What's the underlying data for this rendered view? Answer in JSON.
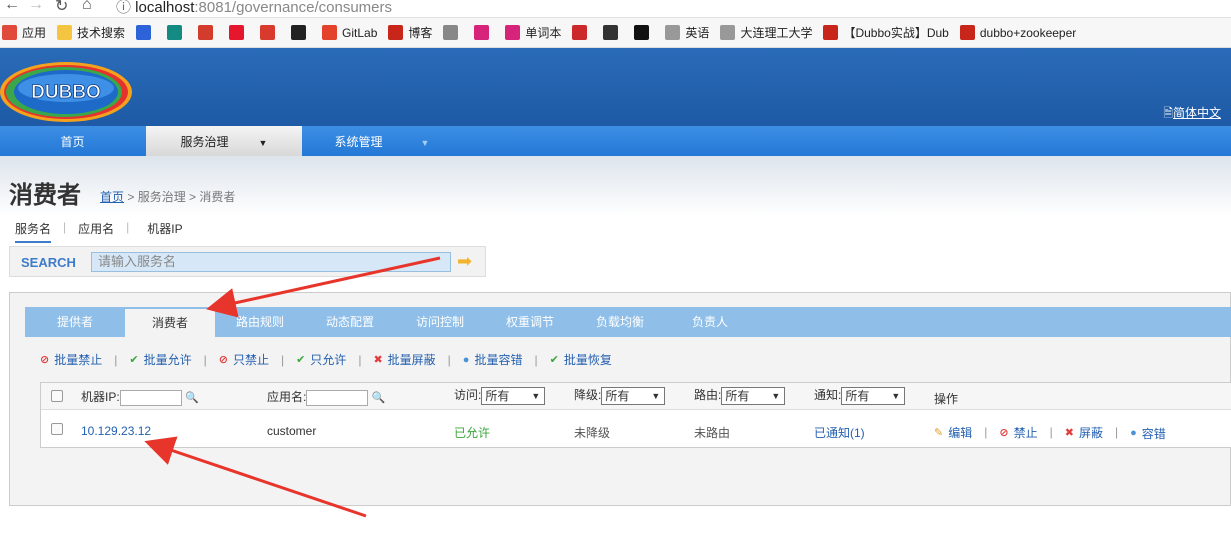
{
  "browser": {
    "url_host": "localhost",
    "url_rest": ":8081/governance/consumers",
    "bookmarks": [
      {
        "label": "应用",
        "icon": "apps-grid-icon",
        "color": "#e04a3a"
      },
      {
        "label": "技术搜索",
        "icon": "folder-icon",
        "color": "#f5c542"
      },
      {
        "label": "",
        "icon": "baidu-paw-icon",
        "color": "#2d62d8"
      },
      {
        "label": "",
        "icon": "bing-icon",
        "color": "#138a82"
      },
      {
        "label": "",
        "icon": "gmail-icon",
        "color": "#d33b2c"
      },
      {
        "label": "",
        "icon": "weibo-icon",
        "color": "#e6162d"
      },
      {
        "label": "",
        "icon": "e-doc-icon",
        "color": "#d83a2e"
      },
      {
        "label": "",
        "icon": "github-icon",
        "color": "#222222"
      },
      {
        "label": "GitLab",
        "icon": "gitlab-icon",
        "color": "#e2432a"
      },
      {
        "label": "博客",
        "icon": "csdn-icon",
        "color": "#c9261b"
      },
      {
        "label": "",
        "icon": "translate-icon",
        "color": "#888888"
      },
      {
        "label": "",
        "icon": "y-icon",
        "color": "#d6247a"
      },
      {
        "label": "单词本",
        "icon": "y-icon",
        "color": "#d6247a"
      },
      {
        "label": "",
        "icon": "h-icon",
        "color": "#cc2a2a"
      },
      {
        "label": "",
        "icon": "link-icon",
        "color": "#333333"
      },
      {
        "label": "",
        "icon": "spade-icon",
        "color": "#111111"
      },
      {
        "label": "英语",
        "icon": "page-icon",
        "color": "#999999"
      },
      {
        "label": "大连理工大学",
        "icon": "page-icon",
        "color": "#999999"
      },
      {
        "label": "【Dubbo实战】Dub",
        "icon": "csdn-icon",
        "color": "#c9261b"
      },
      {
        "label": "dubbo+zookeeper",
        "icon": "csdn-icon",
        "color": "#c9261b"
      }
    ]
  },
  "header": {
    "logo_text": "DUBBO",
    "lang": "简体中文"
  },
  "menu": {
    "items": [
      {
        "label": "首页"
      },
      {
        "label": "服务治理"
      },
      {
        "label": "系统管理"
      }
    ]
  },
  "page": {
    "title": "消费者",
    "breadcrumb_home": "首页",
    "breadcrumb_rest": " > 服务治理 > 消费者"
  },
  "search": {
    "tabs": [
      "服务名",
      "应用名",
      "机器IP"
    ],
    "label": "SEARCH",
    "placeholder": "请输入服务名"
  },
  "tabs": [
    "提供者",
    "消费者",
    "路由规则",
    "动态配置",
    "访问控制",
    "权重调节",
    "负载均衡",
    "负责人"
  ],
  "actions": [
    {
      "label": "批量禁止",
      "icon": "ban-icon",
      "glyph": "⊘",
      "tone": "red"
    },
    {
      "label": "批量允许",
      "icon": "check-icon",
      "glyph": "✔",
      "tone": "green"
    },
    {
      "label": "只禁止",
      "icon": "ban-icon",
      "glyph": "⊘",
      "tone": "red"
    },
    {
      "label": "只允许",
      "icon": "check-icon",
      "glyph": "✔",
      "tone": "green"
    },
    {
      "label": "批量屏蔽",
      "icon": "block-icon",
      "glyph": "✖",
      "tone": "red"
    },
    {
      "label": "批量容错",
      "icon": "tolerance-icon",
      "glyph": "●",
      "tone": "blue"
    },
    {
      "label": "批量恢复",
      "icon": "check-icon",
      "glyph": "✔",
      "tone": "green"
    }
  ],
  "table": {
    "headers": {
      "ip": "机器IP:",
      "app": "应用名:",
      "access": "访问:",
      "degrade": "降级:",
      "route": "路由:",
      "notify": "通知:",
      "ops": "操作"
    },
    "filter_all": "所有",
    "rows": [
      {
        "ip": "10.129.23.12",
        "app": "customer",
        "access": "已允许",
        "degrade": "未降级",
        "route": "未路由",
        "notify": "已通知(1)",
        "ops": [
          "编辑",
          "禁止",
          "屏蔽",
          "容错"
        ]
      }
    ]
  },
  "colors": {
    "header_blue": "#1e5aa5",
    "menu_blue": "#2478d6",
    "tab_blue": "#8fbfe8",
    "link": "#2460b0",
    "arrow_red": "#e8352b"
  }
}
